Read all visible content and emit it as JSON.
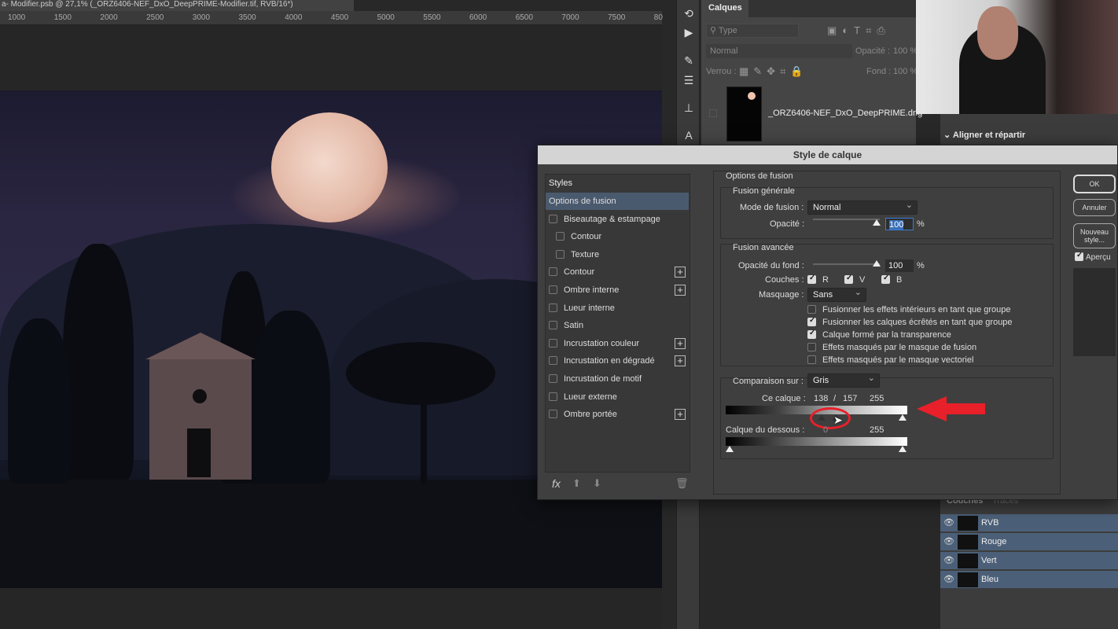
{
  "document": {
    "tab_title": "a- Modifier.psb @ 27,1% (_ORZ6406-NEF_DxO_DeepPRIME-Modifier.tif, RVB/16*)",
    "ruler_ticks": [
      "1000",
      "1500",
      "2000",
      "2500",
      "3000",
      "3500",
      "4000",
      "4500",
      "5000",
      "5500",
      "6000",
      "6500",
      "7000",
      "7500",
      "80"
    ]
  },
  "layers_panel": {
    "tab": "Calques",
    "filter_placeholder": "Type",
    "blend_mode": "Normal",
    "opacity_label": "Opacité :",
    "opacity_value": "100 %",
    "lock_label": "Verrou :",
    "fill_label": "Fond :",
    "fill_value": "100 %",
    "layer_name": "_ORZ6406-NEF_DxO_DeepPRIME.dng"
  },
  "align_panel": {
    "title": "Aligner et répartir"
  },
  "channels_panel": {
    "tabs": [
      "Couches",
      "Tracés"
    ],
    "channels": [
      "RVB",
      "Rouge",
      "Vert",
      "Bleu"
    ]
  },
  "dialog": {
    "title": "Style de calque",
    "styles_header": "Styles",
    "styles": [
      {
        "label": "Options de fusion",
        "selected": true,
        "checkbox": false,
        "plus": false,
        "indent": false
      },
      {
        "label": "Biseautage & estampage",
        "checkbox": true,
        "checked": false,
        "plus": false,
        "indent": false
      },
      {
        "label": "Contour",
        "checkbox": true,
        "checked": false,
        "plus": false,
        "indent": true
      },
      {
        "label": "Texture",
        "checkbox": true,
        "checked": false,
        "plus": false,
        "indent": true
      },
      {
        "label": "Contour",
        "checkbox": true,
        "checked": false,
        "plus": true,
        "indent": false
      },
      {
        "label": "Ombre interne",
        "checkbox": true,
        "checked": false,
        "plus": true,
        "indent": false
      },
      {
        "label": "Lueur interne",
        "checkbox": true,
        "checked": false,
        "plus": false,
        "indent": false
      },
      {
        "label": "Satin",
        "checkbox": true,
        "checked": false,
        "plus": false,
        "indent": false
      },
      {
        "label": "Incrustation couleur",
        "checkbox": true,
        "checked": false,
        "plus": true,
        "indent": false
      },
      {
        "label": "Incrustation en dégradé",
        "checkbox": true,
        "checked": false,
        "plus": true,
        "indent": false
      },
      {
        "label": "Incrustation de motif",
        "checkbox": true,
        "checked": false,
        "plus": false,
        "indent": false
      },
      {
        "label": "Lueur externe",
        "checkbox": true,
        "checked": false,
        "plus": false,
        "indent": false
      },
      {
        "label": "Ombre portée",
        "checkbox": true,
        "checked": false,
        "plus": true,
        "indent": false
      }
    ],
    "fx_label": "fx",
    "section_title": "Options de fusion",
    "general": {
      "title": "Fusion générale",
      "mode_label": "Mode de fusion :",
      "mode_value": "Normal",
      "opacity_label": "Opacité :",
      "opacity_value": "100",
      "pct": "%"
    },
    "advanced": {
      "title": "Fusion avancée",
      "fill_label": "Opacité du fond :",
      "fill_value": "100",
      "pct": "%",
      "channels_label": "Couches :",
      "channels": [
        {
          "label": "R",
          "checked": true
        },
        {
          "label": "V",
          "checked": true
        },
        {
          "label": "B",
          "checked": true
        }
      ],
      "knockout_label": "Masquage :",
      "knockout_value": "Sans",
      "options": [
        {
          "label": "Fusionner les effets intérieurs en tant que groupe",
          "checked": false
        },
        {
          "label": "Fusionner les calques écrêtés en tant que groupe",
          "checked": true
        },
        {
          "label": "Calque formé par la transparence",
          "checked": true
        },
        {
          "label": "Effets masqués par le masque de fusion",
          "checked": false
        },
        {
          "label": "Effets masqués par le masque vectoriel",
          "checked": false
        }
      ]
    },
    "blend_if": {
      "label": "Comparaison sur :",
      "value": "Gris",
      "this_layer_label": "Ce calque :",
      "this_layer_low": "138",
      "separator": "/",
      "this_layer_low2": "157",
      "this_layer_high": "255",
      "underlying_label": "Calque du dessous :",
      "underlying_low": "0",
      "underlying_high": "255"
    },
    "buttons": {
      "ok": "OK",
      "cancel": "Annuler",
      "new_style": "Nouveau style...",
      "preview": "Aperçu"
    },
    "preview_checked": true
  },
  "annotation_color": "#e8202a"
}
